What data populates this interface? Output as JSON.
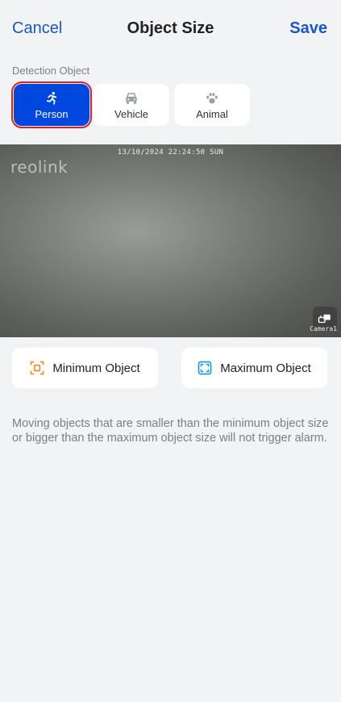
{
  "header": {
    "cancel_label": "Cancel",
    "title": "Object Size",
    "save_label": "Save"
  },
  "detection": {
    "label": "Detection Object",
    "options": [
      {
        "label": "Person",
        "icon": "running-person-icon",
        "selected": true
      },
      {
        "label": "Vehicle",
        "icon": "car-icon",
        "selected": false
      },
      {
        "label": "Animal",
        "icon": "paw-icon",
        "selected": false
      }
    ]
  },
  "camera": {
    "timestamp": "13/10/2024 22:24:50 SUN",
    "brand": "reolink",
    "name": "Camera1"
  },
  "size_buttons": {
    "minimum_label": "Minimum Object",
    "maximum_label": "Maximum Object"
  },
  "note": "Moving objects that are smaller than the minimum object size or bigger than the maximum object size will not trigger alarm.",
  "colors": {
    "accent": "#1a56c8",
    "selected_bg": "#0047e0",
    "highlight_border": "#e02020",
    "min_icon": "#f28c28",
    "max_icon": "#1a9ad6"
  }
}
